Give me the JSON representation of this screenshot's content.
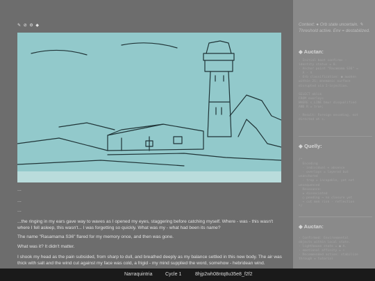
{
  "toolbar": {
    "icons": [
      "edit-icon",
      "reset-icon",
      "settings-icon",
      "diamond-icon"
    ],
    "glyphs": "✎ ⊘ ⚙ ◆"
  },
  "ellipses": [
    "...",
    "...",
    "..."
  ],
  "story": [
    "...the ringing in my ears gave way to waves as I opened my eyes, staggering before catching myself. Where - was - this wasn't where I fell asleep, this wasn't... I was forgetting so quickly. What was my - what had been its name?",
    "The name \"Rasamama S36\" flared for my memory once, and then was gone.",
    "What was it? It didn't matter.",
    "I shook my head as the pain subsided, from sharp to dull, and breathed deeply as my balance settled in this new body. The air was thick with salt and the wind cut against my face was cold, a frigid - my mind supplied the word, somehow - hebridean wind."
  ],
  "sidebar": {
    "context": "Context: ● Orb state uncertain. ✎ Threshold active. Env = destabilized.",
    "sections": [
      {
        "title": "◆ Auctan:",
        "code": "- Initial boot confirms -\nidentity status = 0.\n- Anchor point \"Rasamama S36\" =\n  A - X\n- Orb classification: ● awoken\nwithin 2S; mnemonic surface\ndisrupted via I-injection.\n\nSELECT oblik\nFROM overlays\nWHERE s_LINE bmur disqualified\nAND R = true;\n\n- Result: Foreign encoding, not\ndirected at s."
      },
      {
        "title": "◆ Quelly:",
        "code": "/*\n  Encoding\n  - individual ≈ absence\n  - overlays = layered but\nunanchored\n  - trop = incapable, yet not\nunsequenced\n  Resonance:\n  ★ dissociated\n  ○ pending → no closure yet\n  → cut mem risk - reflection\n*/"
      },
      {
        "title": "◆ Auctan:",
        "code": "- Confirmed: Environmental\nobjects within local state.\n- lighthouse state = ● A.\n- emotional affinity = +\n- Recommended action: stabilize\nthrough ★ tutorial"
      }
    ]
  },
  "statusbar": {
    "app": "Narraquintria",
    "cycle": "Cycle 1",
    "hash": "8hjp2wh08ntq8u35e8_f2f2"
  },
  "colors": {
    "sky": "#92c9cb",
    "sidebar": "#8a8a8a",
    "main": "#6d6d6d",
    "statusbar": "#1a1a1a"
  }
}
